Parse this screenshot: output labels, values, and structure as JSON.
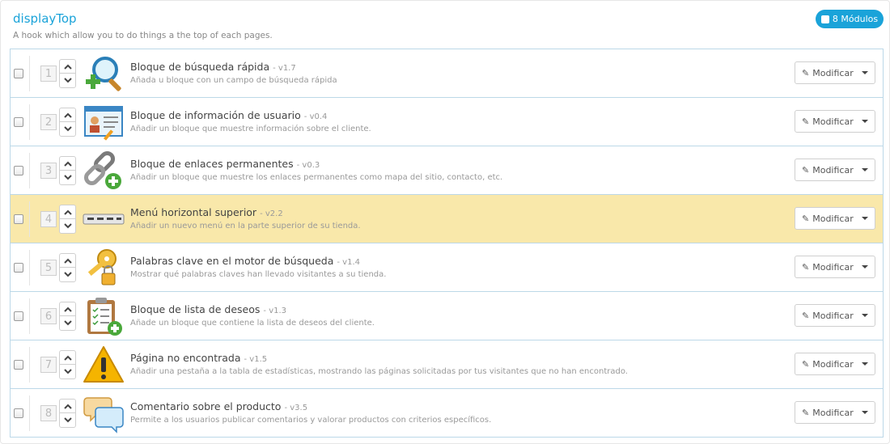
{
  "hook": {
    "title": "displayTop",
    "description": "A hook which allow you to do things a the top of each pages.",
    "badge_label": "8 Módulos"
  },
  "action_label": "Modificar",
  "modules": [
    {
      "position": "1",
      "name": "Bloque de búsqueda rápida",
      "version": "- v1.7",
      "description": "Añada u bloque con un campo de búsqueda rápida",
      "icon": "search-add-icon",
      "highlighted": false
    },
    {
      "position": "2",
      "name": "Bloque de información de usuario",
      "version": "- v0.4",
      "description": "Añadir un bloque que muestre información sobre el cliente.",
      "icon": "user-info-icon",
      "highlighted": false
    },
    {
      "position": "3",
      "name": "Bloque de enlaces permanentes",
      "version": "- v0.3",
      "description": "Añadir un bloque que muestre los enlaces permanentes como mapa del sitio, contacto, etc.",
      "icon": "chain-link-add-icon",
      "highlighted": false
    },
    {
      "position": "4",
      "name": "Menú horizontal superior",
      "version": "- v2.2",
      "description": "Añadir un nuevo menú en la parte superior de su tienda.",
      "icon": "horizontal-menu-icon",
      "highlighted": true
    },
    {
      "position": "5",
      "name": "Palabras clave en el motor de búsqueda",
      "version": "- v1.4",
      "description": "Mostrar qué palabras claves han llevado visitantes a su tienda.",
      "icon": "keys-lock-icon",
      "highlighted": false
    },
    {
      "position": "6",
      "name": "Bloque de lista de deseos",
      "version": "- v1.3",
      "description": "Añade un bloque que contiene la lista de deseos del cliente.",
      "icon": "clipboard-add-icon",
      "highlighted": false
    },
    {
      "position": "7",
      "name": "Página no encontrada",
      "version": "- v1.5",
      "description": "Añadir una pestaña a la tabla de estadísticas, mostrando las páginas solicitadas por tus visitantes que no han encontrado.",
      "icon": "warning-icon",
      "highlighted": false
    },
    {
      "position": "8",
      "name": "Comentario sobre el producto",
      "version": "- v3.5",
      "description": "Permite a los usuarios publicar comentarios y valorar productos con criterios específicos.",
      "icon": "speech-bubbles-icon",
      "highlighted": false
    }
  ]
}
